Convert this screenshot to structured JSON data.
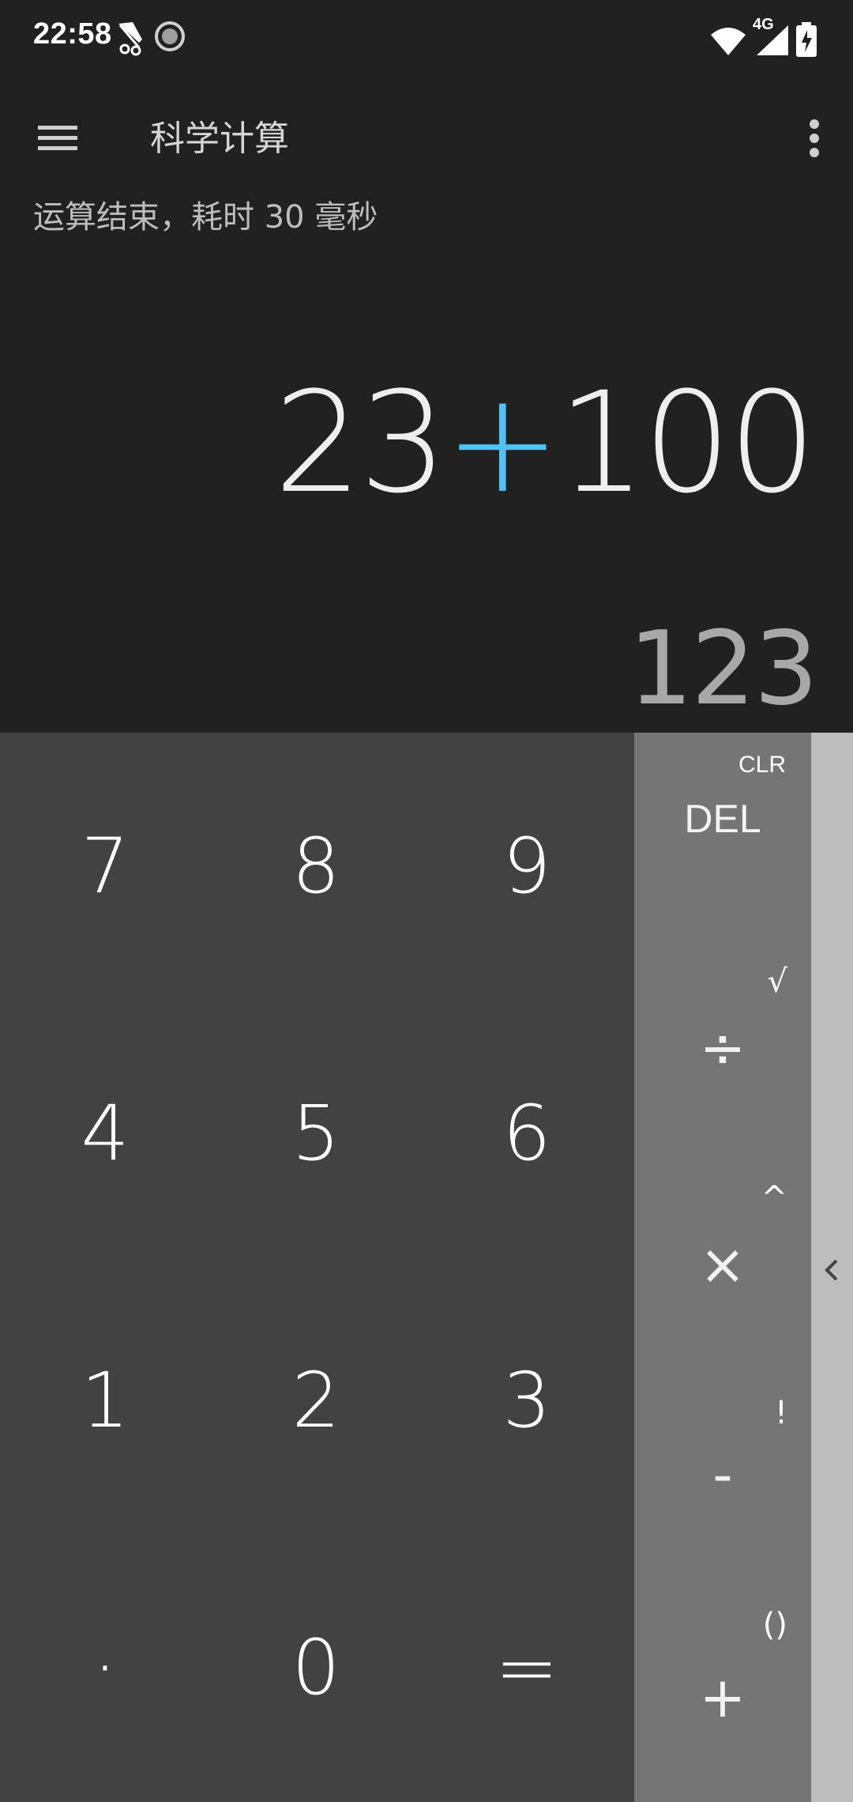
{
  "status_bar": {
    "time": "22:58",
    "network": "4G",
    "icons": [
      "notification-icon",
      "sync-icon",
      "wifi-icon",
      "cell-signal-icon",
      "battery-icon"
    ]
  },
  "toolbar": {
    "title": "科学计算",
    "menu_icon": "hamburger-menu-icon",
    "overflow_icon": "more-vert-icon"
  },
  "status_message": "运算结束，耗时 30 毫秒",
  "display": {
    "formula_left": "23",
    "formula_op": "+",
    "formula_right": "100",
    "result": "123"
  },
  "keypad": {
    "row1": [
      "7",
      "8",
      "9"
    ],
    "row2": [
      "4",
      "5",
      "6"
    ],
    "row3": [
      "1",
      "2",
      "3"
    ],
    "row4": [
      "·",
      "0",
      "="
    ]
  },
  "operators": {
    "clr": "CLR",
    "del": "DEL",
    "divide": "÷",
    "multiply": "×",
    "minus": "-",
    "plus": "+",
    "sqrt": "√",
    "power": "^",
    "factorial": "!",
    "parens": "()"
  },
  "colors": {
    "background": "#212121",
    "numpad": "#424242",
    "oppad": "#757575",
    "sidepad": "#bdbdbd",
    "accent": "#4fc3f7"
  }
}
